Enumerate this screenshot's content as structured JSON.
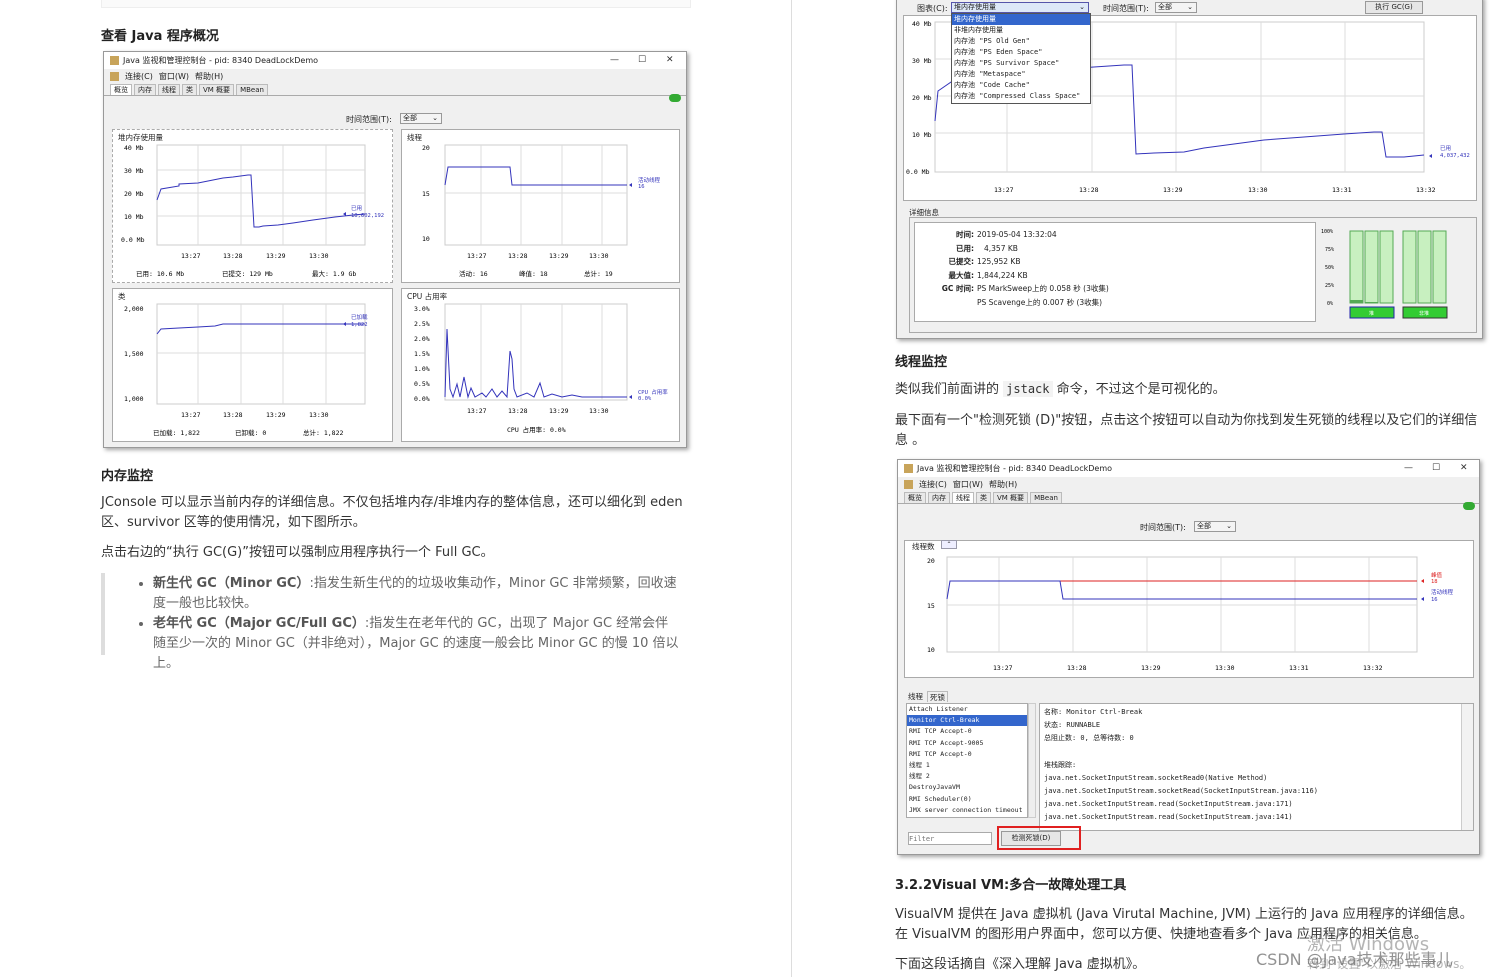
{
  "left": {
    "h_overview": "查看 Java 程序概况",
    "h_memory": "内存监控",
    "p_memory1": "JConsole 可以显示当前内存的详细信息。不仅包括堆内存/非堆内存的整体信息，还可以细化到 eden 区、survivor 区等的使用情况，如下图所示。",
    "p_memory2": "点击右边的“执行 GC(G)”按钮可以强制应用程序执行一个 Full GC。",
    "list": [
      {
        "bold": "新生代 GC（Minor GC）",
        "text": ":指发生新生代的的垃圾收集动作，Minor GC 非常频繁，回收速度一般也比较快。"
      },
      {
        "bold": "老年代 GC（Major GC/Full GC）",
        "text": ":指发生在老年代的 GC，出现了 Major GC 经常会伴随至少一次的 Minor GC（并非绝对），Major GC 的速度一般会比 Minor GC 的慢 10 倍以上。"
      }
    ]
  },
  "win1": {
    "title": "Java 监视和管理控制台 - pid: 8340 DeadLockDemo",
    "menu": [
      "连接(C)",
      "窗口(W)",
      "帮助(H)"
    ],
    "tabs": [
      "概览",
      "内存",
      "线程",
      "类",
      "VM 概要",
      "MBean"
    ],
    "time_range_label": "时间范围(T):",
    "time_range_value": "全部",
    "panels": {
      "heap": {
        "title": "堆内存使用量",
        "yticks": [
          "40 Mb",
          "30 Mb",
          "20 Mb",
          "10 Mb",
          "0.0 Mb"
        ],
        "legend_name": "已用",
        "legend_value": "10,602,192",
        "footer": [
          "已用:  10.6  Mb",
          "已提交:  129  Mb",
          "最大:  1.9  Gb"
        ]
      },
      "threads": {
        "title": "线程",
        "yticks": [
          "20",
          "15",
          "10"
        ],
        "legend_name": "活动线程",
        "legend_value": "16",
        "footer": [
          "活动:  16",
          "峰值:  18",
          "总计:  19"
        ]
      },
      "classes": {
        "title": "类",
        "yticks": [
          "2,000",
          "1,500",
          "1,000"
        ],
        "legend_name": "已加载",
        "legend_value": "1,822",
        "footer": [
          "已加载:  1,822",
          "已卸载:  0",
          "总计:  1,822"
        ]
      },
      "cpu": {
        "title": "CPU 占用率",
        "yticks": [
          "3.0%",
          "2.5%",
          "2.0%",
          "1.5%",
          "1.0%",
          "0.5%",
          "0.0%"
        ],
        "legend_name": "CPU 占用率",
        "legend_value": "0.0%",
        "footer": [
          "CPU 占用率: 0.0%"
        ]
      }
    },
    "xticks": [
      "13:27",
      "13:28",
      "13:29",
      "13:30"
    ]
  },
  "win2": {
    "chart_label": "图表(C):",
    "chart_value": "堆内存使用量",
    "time_range_label": "时间范围(T):",
    "time_range_value": "全部",
    "gc_button": "执行 GC(G)",
    "dropdown": [
      "堆内存使用量",
      "非堆内存使用量",
      "内存池 \"PS Old Gen\"",
      "内存池 \"PS Eden Space\"",
      "内存池 \"PS Survivor Space\"",
      "内存池 \"Metaspace\"",
      "内存池 \"Code Cache\"",
      "内存池 \"Compressed Class Space\""
    ],
    "yticks": [
      "40 Mb",
      "30 Mb",
      "20 Mb",
      "10 Mb",
      "0.0 Mb"
    ],
    "xticks": [
      "13:27",
      "13:28",
      "13:29",
      "13:30",
      "13:31",
      "13:32"
    ],
    "legend_name": "已用",
    "legend_value": "4,037,432",
    "details_title": "详细信息",
    "details": [
      {
        "k": "时间:",
        "v": "2019-05-04 13:32:04"
      },
      {
        "k": "已用:",
        "v": "4,357 KB"
      },
      {
        "k": "已提交:",
        "v": "125,952 KB"
      },
      {
        "k": "最大值:",
        "v": "1,844,224 KB"
      },
      {
        "k": "GC 时间:",
        "v": "PS MarkSweep上的        0.058 秒 (3收集)"
      },
      {
        "k": "",
        "v": "PS Scavenge上的        0.007 秒 (3收集)"
      }
    ],
    "bar_yticks": [
      "100%",
      "75%",
      "50%",
      "25%",
      "0%"
    ],
    "bar_labels": [
      "堆",
      "非堆"
    ]
  },
  "right": {
    "h_thread": "线程监控",
    "p_thread1_a": "类似我们前面讲的",
    "p_thread1_code": "jstack",
    "p_thread1_b": "命令，不过这个是可视化的。",
    "p_thread2": "最下面有一个\"检测死锁 (D)\"按钮，点击这个按钮可以自动为你找到发生死锁的线程以及它们的详细信息 。",
    "h_visualvm": "3.2.2Visual VM:多合一故障处理工具",
    "p_visualvm": "VisualVM 提供在 Java 虚拟机 (Java Virutal Machine, JVM) 上运行的 Java 应用程序的详细信息。在 VisualVM 的图形用户界面中，您可以方便、快捷地查看多个 Java 应用程序的相关信息。",
    "p_last": "下面这段话摘自《深入理解 Java 虚拟机》。"
  },
  "win3": {
    "title": "Java 监视和管理控制台 - pid: 8340 DeadLockDemo",
    "menu": [
      "连接(C)",
      "窗口(W)",
      "帮助(H)"
    ],
    "tabs": [
      "概览",
      "内存",
      "线程",
      "类",
      "VM 概要",
      "MBean"
    ],
    "time_range_label": "时间范围(T):",
    "time_range_value": "全部",
    "chart_title": "线程数",
    "yticks": [
      "20",
      "15",
      "10"
    ],
    "xticks": [
      "13:27",
      "13:28",
      "13:29",
      "13:30",
      "13:31",
      "13:32"
    ],
    "legend_peak_name": "峰值",
    "legend_peak_value": "18",
    "legend_live_name": "活动线程",
    "legend_live_value": "16",
    "sub_tabs": [
      "线程",
      "死锁"
    ],
    "threads": [
      "Attach Listener",
      "Monitor Ctrl-Break",
      "RMI TCP Accept-0",
      "RMI TCP Accept-9005",
      "RMI TCP Accept-0",
      "线程 1",
      "线程 2",
      "DestroyJavaVM",
      "RMI Scheduler(0)",
      "JMX server connection timeout"
    ],
    "detail_lines": [
      "名称: Monitor Ctrl-Break",
      "状态: RUNNABLE",
      "总阻止数: 0, 总等待数: 0",
      "",
      "堆栈跟踪:",
      "java.net.SocketInputStream.socketRead0(Native Method)",
      "java.net.SocketInputStream.socketRead(SocketInputStream.java:116)",
      "java.net.SocketInputStream.read(SocketInputStream.java:171)",
      "java.net.SocketInputStream.read(SocketInputStream.java:141)"
    ],
    "filter_placeholder": "Filter",
    "deadlock_button": "检测死锁(D)"
  },
  "watermark": {
    "windows": "激活 Windows",
    "windows_sub": "转到\"设置\"以激活 Windows。",
    "csdn": "CSDN @Java技术那些事儿"
  }
}
